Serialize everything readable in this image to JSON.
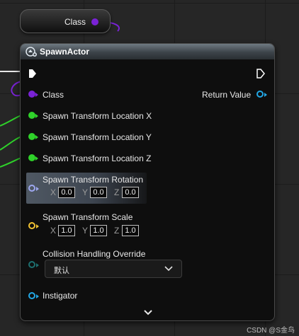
{
  "class_node": {
    "label": "Class",
    "pin_color": "#7a22d6"
  },
  "node": {
    "title": "SpawnActor",
    "icon": "spawn-actor-icon",
    "header_color": "#5e6870",
    "return_label": "Return Value",
    "pins": [
      {
        "label": "Class",
        "color": "#7a22d6",
        "type": "filled"
      },
      {
        "label": "Spawn Transform Location X",
        "color": "#2fd22a",
        "type": "filled"
      },
      {
        "label": "Spawn Transform Location Y",
        "color": "#2fd22a",
        "type": "filled"
      },
      {
        "label": "Spawn Transform Location Z",
        "color": "#2fd22a",
        "type": "filled"
      }
    ],
    "rotation": {
      "label": "Spawn Transform Rotation",
      "color": "#9ea8f0",
      "x": "0.0",
      "y": "0.0",
      "z": "0.0"
    },
    "scale": {
      "label": "Spawn Transform Scale",
      "color": "#f2c232",
      "x": "1.0",
      "y": "1.0",
      "z": "1.0"
    },
    "collision": {
      "label": "Collision Handling Override",
      "color": "#1d6f6f",
      "value": "默认"
    },
    "instigator": {
      "label": "Instigator",
      "color": "#22a8e6"
    },
    "axis_labels": {
      "x": "X",
      "y": "Y",
      "z": "Z"
    }
  },
  "watermark": "CSDN @S金鸟"
}
